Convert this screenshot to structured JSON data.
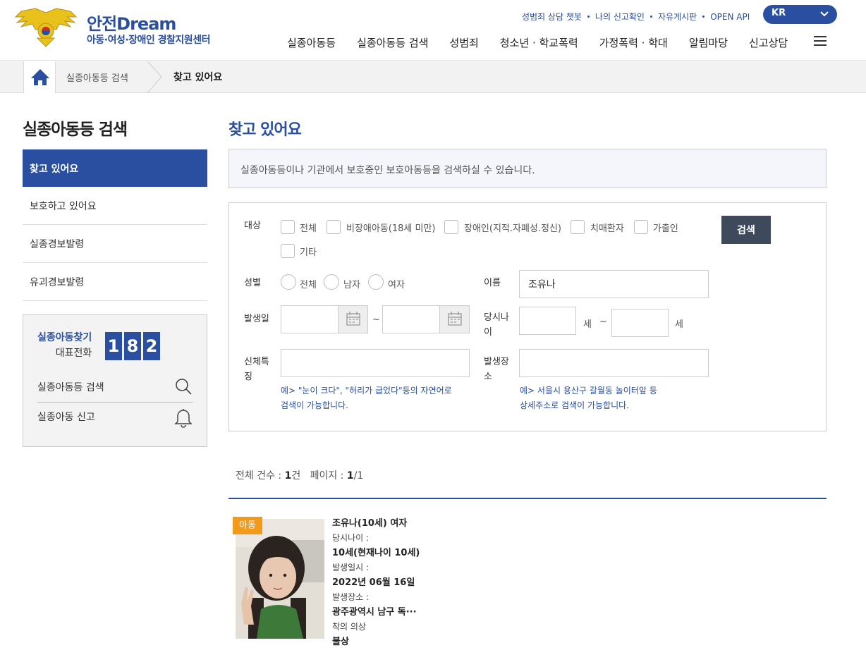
{
  "header": {
    "logo_title": "안전Dream",
    "logo_subtitle": "아동·여성·장애인 경찰지원센터",
    "util_links": [
      "성범죄 상담 챗봇",
      "나의 신고확인",
      "자유게시판",
      "OPEN API"
    ],
    "language": "KR",
    "nav": [
      "실종아동등",
      "실종아동등 검색",
      "성범죄",
      "청소년 · 학교폭력",
      "가정폭력 · 학대",
      "알림마당",
      "신고상담"
    ]
  },
  "breadcrumb": {
    "section": "실종아동등 검색",
    "current": "찾고 있어요"
  },
  "sidebar": {
    "title": "실종아동등 검색",
    "items": [
      {
        "label": "찾고 있어요",
        "active": true
      },
      {
        "label": "보호하고 있어요"
      },
      {
        "label": "실종경보발령"
      },
      {
        "label": "유괴경보발령"
      }
    ],
    "hotline_label": "실종아동찾기",
    "hotline_sub": "대표전화",
    "hotline_digits": [
      "1",
      "8",
      "2"
    ],
    "link_search": "실종아동등 검색",
    "link_report": "실종아동 신고"
  },
  "main": {
    "title": "찾고 있어요",
    "notice": "실종아동등이나 기관에서 보호중인 보호아동등을 검색하실 수 있습니다.",
    "form": {
      "target_label": "대상",
      "target_options": [
        "전체",
        "비장애아동(18세 미만)",
        "장애인(지적.자폐성.정신)",
        "치매환자",
        "가출인",
        "기타"
      ],
      "search_button": "검색",
      "gender_label": "성별",
      "gender_options": [
        "전체",
        "남자",
        "여자"
      ],
      "name_label": "이름",
      "name_value": "조유나",
      "date_label": "발생일",
      "date_sep": "~",
      "age_label_1": "당시나",
      "age_label_2": "이",
      "age_unit": "세",
      "age_sep": "~",
      "body_label_1": "신체특",
      "body_label_2": "징",
      "body_hint_1": "예> \"눈이 크다\", \"허리가 굽었다\"등의 자연어로",
      "body_hint_2": "검색이 가능합니다.",
      "place_label_1": "발생장",
      "place_label_2": "소",
      "place_hint_1": "예> 서울시 용산구 갈월동 놀이터앞 등",
      "place_hint_2": "상세주소로 검색이 가능합니다."
    },
    "results": {
      "total_label": "전체 건수 : ",
      "total_value": "1",
      "total_unit": "건",
      "page_label": "페이지 : ",
      "page_current": "1",
      "page_total": "/1",
      "items": [
        {
          "badge": "아동",
          "name": "조유나(10세) 여자",
          "age_label": "당시나이 :",
          "age_value": "10세(현재나이 10세)",
          "date_label": "발생일시 :",
          "date_value": "2022년 06월 16일",
          "place_label": "발생장소 :",
          "place_value": "광주광역시 남구 독···",
          "clothes_label": "착의 의상",
          "clothes_value": "불상"
        }
      ]
    }
  },
  "colors": {
    "brand": "#2a4ea0",
    "badge": "#f29a1c",
    "button": "#3e4a5c"
  }
}
